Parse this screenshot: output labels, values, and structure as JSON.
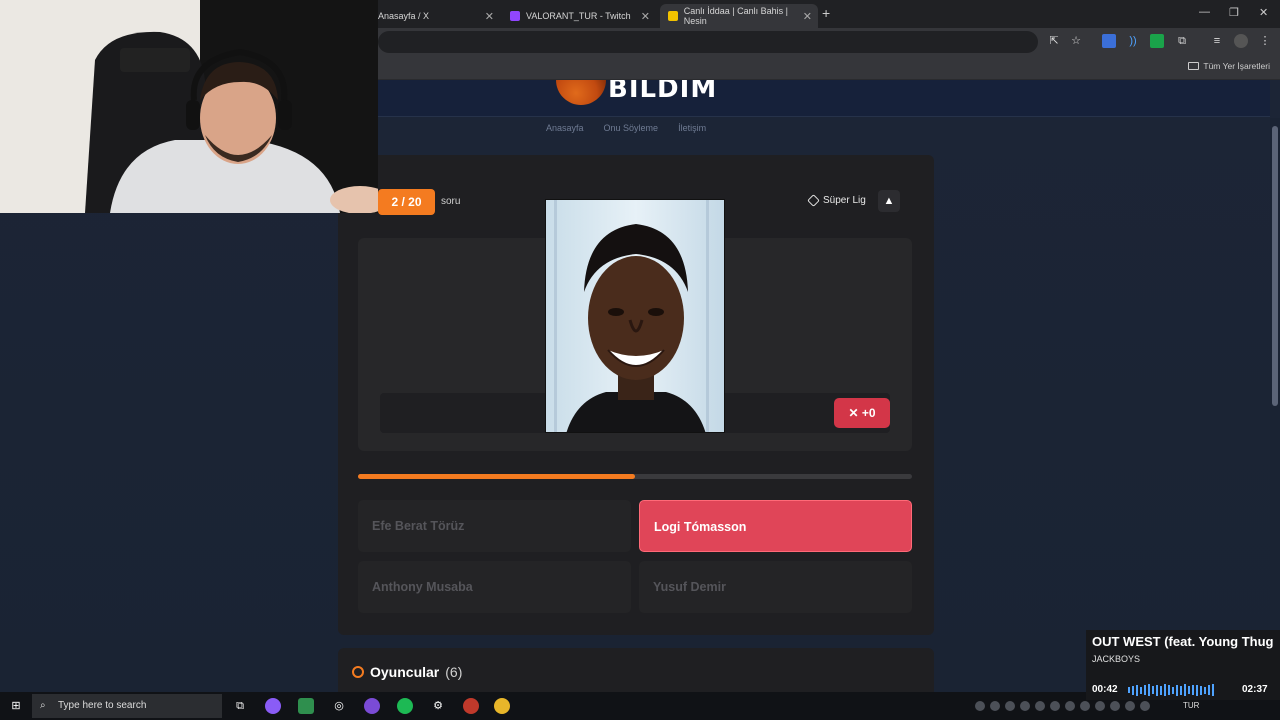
{
  "browser": {
    "tabs": [
      {
        "title": "Anasayfa / X"
      },
      {
        "title": "VALORANT_TUR - Twitch"
      },
      {
        "title": "Canlı İddaa | Canlı Bahis | Nesin"
      }
    ],
    "new_tab_symbol": "+",
    "bookmarks_label": "Tüm Yer İşaretleri"
  },
  "site": {
    "logo_text": "BİLDİM",
    "nav": [
      "Anasayfa",
      "Onu Söyleme",
      "İletişim"
    ]
  },
  "quiz": {
    "question_counter": "2 / 20",
    "question_word": "soru",
    "league": "Süper Lig",
    "score_delta": "+0",
    "progress_fraction": 0.5,
    "options": [
      {
        "label": "Efe Berat Törüz",
        "state": "disabled"
      },
      {
        "label": "Logi Tómasson",
        "state": "wrong"
      },
      {
        "label": "Anthony Musaba",
        "state": "disabled"
      },
      {
        "label": "Yusuf Demir",
        "state": "disabled"
      }
    ]
  },
  "players_section": {
    "title": "Oyuncular",
    "count": "(6)"
  },
  "now_playing": {
    "song": "OUT WEST (feat. Young Thug",
    "artist": "JACKBOYS",
    "elapsed": "00:42",
    "duration": "02:37"
  },
  "taskbar": {
    "search_placeholder": "Type here to search",
    "lang": "TUR"
  },
  "colors": {
    "accent": "#f47b20",
    "wrong": "#e04558",
    "score_button": "#d33648"
  }
}
